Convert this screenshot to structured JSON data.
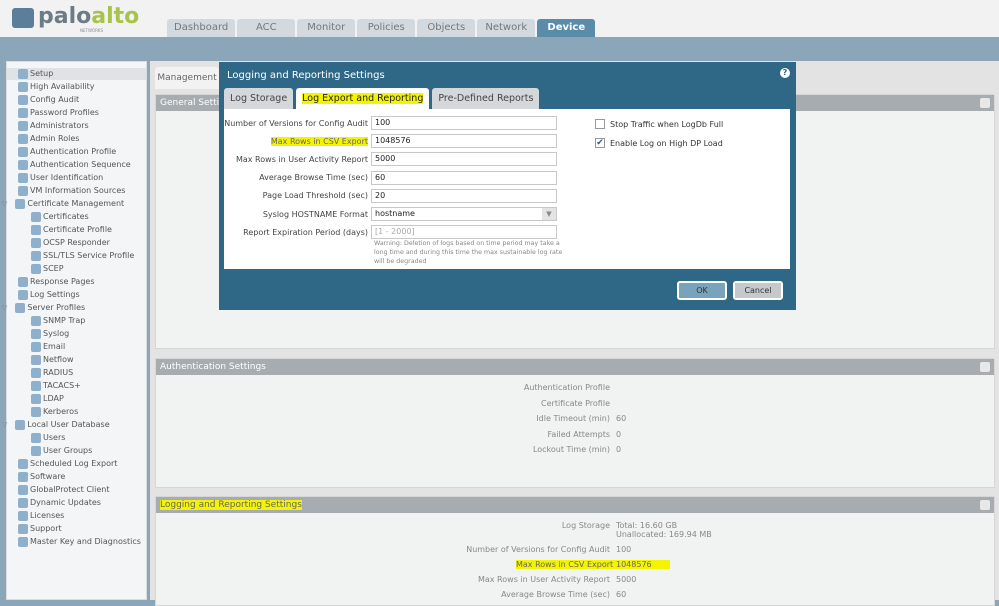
{
  "brand": {
    "name_part1": "palo",
    "name_part2": "alto",
    "sub": "NETWORKS"
  },
  "nav_tabs": [
    "Dashboard",
    "ACC",
    "Monitor",
    "Policies",
    "Objects",
    "Network",
    "Device"
  ],
  "sidebar": [
    {
      "label": "Setup",
      "level": 0,
      "selected": true
    },
    {
      "label": "High Availability",
      "level": 0
    },
    {
      "label": "Config Audit",
      "level": 0
    },
    {
      "label": "Password Profiles",
      "level": 0
    },
    {
      "label": "Administrators",
      "level": 0
    },
    {
      "label": "Admin Roles",
      "level": 0
    },
    {
      "label": "Authentication Profile",
      "level": 0
    },
    {
      "label": "Authentication Sequence",
      "level": 0
    },
    {
      "label": "User Identification",
      "level": 0
    },
    {
      "label": "VM Information Sources",
      "level": 0
    },
    {
      "label": "Certificate Management",
      "level": 0,
      "expanded": true
    },
    {
      "label": "Certificates",
      "level": 1
    },
    {
      "label": "Certificate Profile",
      "level": 1
    },
    {
      "label": "OCSP Responder",
      "level": 1
    },
    {
      "label": "SSL/TLS Service Profile",
      "level": 1
    },
    {
      "label": "SCEP",
      "level": 1
    },
    {
      "label": "Response Pages",
      "level": 0
    },
    {
      "label": "Log Settings",
      "level": 0
    },
    {
      "label": "Server Profiles",
      "level": 0,
      "expanded": true
    },
    {
      "label": "SNMP Trap",
      "level": 1
    },
    {
      "label": "Syslog",
      "level": 1
    },
    {
      "label": "Email",
      "level": 1
    },
    {
      "label": "Netflow",
      "level": 1
    },
    {
      "label": "RADIUS",
      "level": 1
    },
    {
      "label": "TACACS+",
      "level": 1
    },
    {
      "label": "LDAP",
      "level": 1
    },
    {
      "label": "Kerberos",
      "level": 1
    },
    {
      "label": "Local User Database",
      "level": 0,
      "expanded": true
    },
    {
      "label": "Users",
      "level": 1
    },
    {
      "label": "User Groups",
      "level": 1
    },
    {
      "label": "Scheduled Log Export",
      "level": 0
    },
    {
      "label": "Software",
      "level": 0
    },
    {
      "label": "GlobalProtect Client",
      "level": 0
    },
    {
      "label": "Dynamic Updates",
      "level": 0
    },
    {
      "label": "Licenses",
      "level": 0
    },
    {
      "label": "Support",
      "level": 0
    },
    {
      "label": "Master Key and Diagnostics",
      "level": 0
    }
  ],
  "main": {
    "tab": "Management",
    "general_title": "General Settings",
    "auth": {
      "title": "Authentication Settings",
      "rows": [
        [
          "Authentication Profile",
          ""
        ],
        [
          "Certificate Profile",
          ""
        ],
        [
          "Idle Timeout (min)",
          "60"
        ],
        [
          "Failed Attempts",
          "0"
        ],
        [
          "Lockout Time (min)",
          "0"
        ]
      ]
    },
    "logging": {
      "title": "Logging and Reporting Settings",
      "log_storage_label": "Log Storage",
      "log_storage_total": "Total: 16.60 GB",
      "log_storage_unalloc": "Unallocated: 169.94 MB",
      "rows": [
        [
          "Number of Versions for Config Audit",
          "100"
        ],
        [
          "Max Rows in CSV Export",
          "1048576"
        ],
        [
          "Max Rows in User Activity Report",
          "5000"
        ],
        [
          "Average Browse Time (sec)",
          "60"
        ]
      ]
    }
  },
  "dialog": {
    "title": "Logging and Reporting Settings",
    "help": "?",
    "tabs": [
      "Log Storage",
      "Log Export and Reporting",
      "Pre-Defined Reports"
    ],
    "fields": [
      {
        "label": "Number of Versions for Config Audit",
        "value": "100"
      },
      {
        "label": "Max Rows in CSV Export",
        "value": "1048576"
      },
      {
        "label": "Max Rows in User Activity Report",
        "value": "5000"
      },
      {
        "label": "Average Browse Time (sec)",
        "value": "60"
      },
      {
        "label": "Page Load Threshold (sec)",
        "value": "20"
      },
      {
        "label": "Syslog HOSTNAME Format",
        "value": "hostname"
      },
      {
        "label": "Report Expiration Period (days)",
        "placeholder": "[1 - 2000]"
      }
    ],
    "warning": "Warning: Deletion of logs based on time period may take a long time and during this time the max sustainable log rate will be degraded",
    "checkboxes": [
      {
        "label": "Stop Traffic when LogDb Full",
        "checked": false
      },
      {
        "label": "Enable Log on High DP Load",
        "checked": true
      }
    ],
    "ok": "OK",
    "cancel": "Cancel"
  }
}
